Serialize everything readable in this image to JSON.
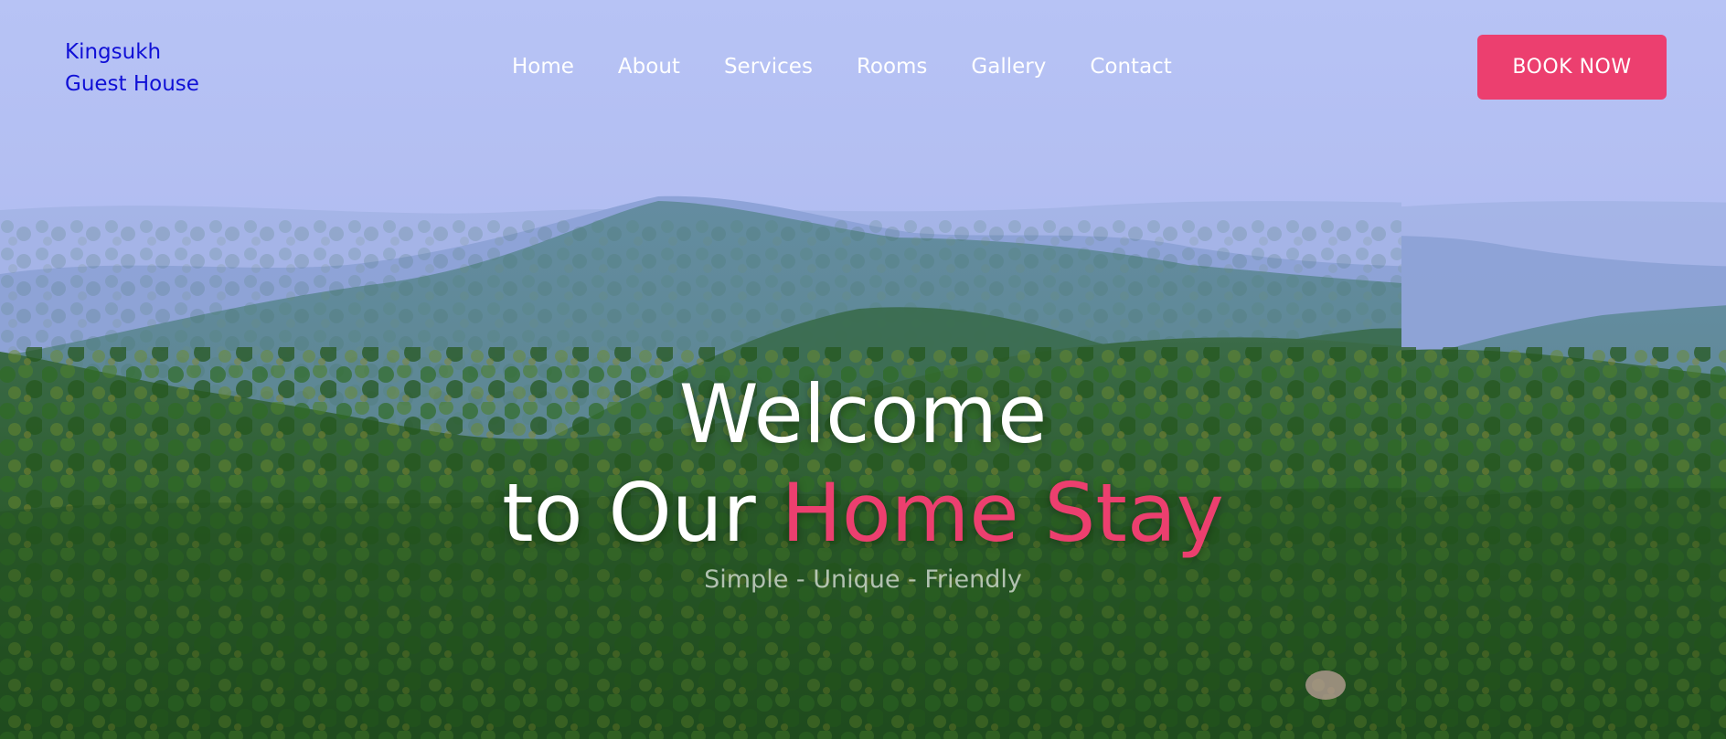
{
  "brand": {
    "line1": "Kingsukh",
    "line2": "Guest House"
  },
  "nav": {
    "items": [
      "Home",
      "About",
      "Services",
      "Rooms",
      "Gallery",
      "Contact"
    ]
  },
  "cta": {
    "label": "BOOK NOW"
  },
  "hero": {
    "line1": "Welcome",
    "line2_prefix": "to Our",
    "line2_accent": "Home Stay",
    "tagline": "Simple - Unique - Friendly"
  },
  "colors": {
    "brand": "#1010d6",
    "accent": "#ec3f6f",
    "nav_text": "#ffffff",
    "tagline": "#e8ece8"
  }
}
